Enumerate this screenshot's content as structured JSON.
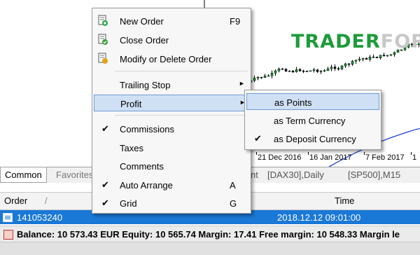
{
  "watermark": {
    "part1": "TRADER",
    "part2": "FOREX"
  },
  "chart_axis": {
    "dates": [
      "21 Dec 2016",
      "16 Jan 2017",
      "7 Feb 2017",
      "1"
    ]
  },
  "tabs": {
    "common": "Common",
    "favorites": "Favorites",
    "symbols": [
      "nt",
      "[DAX30],Daily",
      "[SP500],M15"
    ]
  },
  "terminal": {
    "col_order": "Order",
    "col_order_sort": "/",
    "col_time": "Time",
    "row": {
      "order": "141053240",
      "time": "2018.12.12 09:01:00"
    },
    "balance_text": "Balance: 10 573.43 EUR  Equity: 10 565.74  Margin: 17.41  Free margin: 10 548.33  Margin le"
  },
  "menu": {
    "items": [
      {
        "label": "New Order",
        "shortcut": "F9",
        "icon": "new-order-icon"
      },
      {
        "label": "Close Order",
        "icon": "close-order-icon"
      },
      {
        "label": "Modify or Delete Order",
        "icon": "modify-order-icon"
      },
      {
        "label": "Trailing Stop",
        "submenu": true
      },
      {
        "label": "Profit",
        "submenu": true,
        "highlighted": true
      },
      {
        "label": "Commissions",
        "checked": true
      },
      {
        "label": "Taxes"
      },
      {
        "label": "Comments"
      },
      {
        "label": "Auto Arrange",
        "shortcut": "A",
        "checked": true
      },
      {
        "label": "Grid",
        "shortcut": "G",
        "checked": true
      }
    ]
  },
  "submenu": {
    "items": [
      {
        "label": "as Points",
        "highlighted": true
      },
      {
        "label": "as Term Currency"
      },
      {
        "label": "as Deposit Currency",
        "checked": true
      }
    ]
  },
  "glyphs": {
    "check": "✔",
    "arrow": "►"
  },
  "colors": {
    "selection_blue": "#1a78d6",
    "menu_highlight": "#cfe0f4",
    "candle_up": "#1e9b3a",
    "ma_line": "#1f3fd1"
  }
}
